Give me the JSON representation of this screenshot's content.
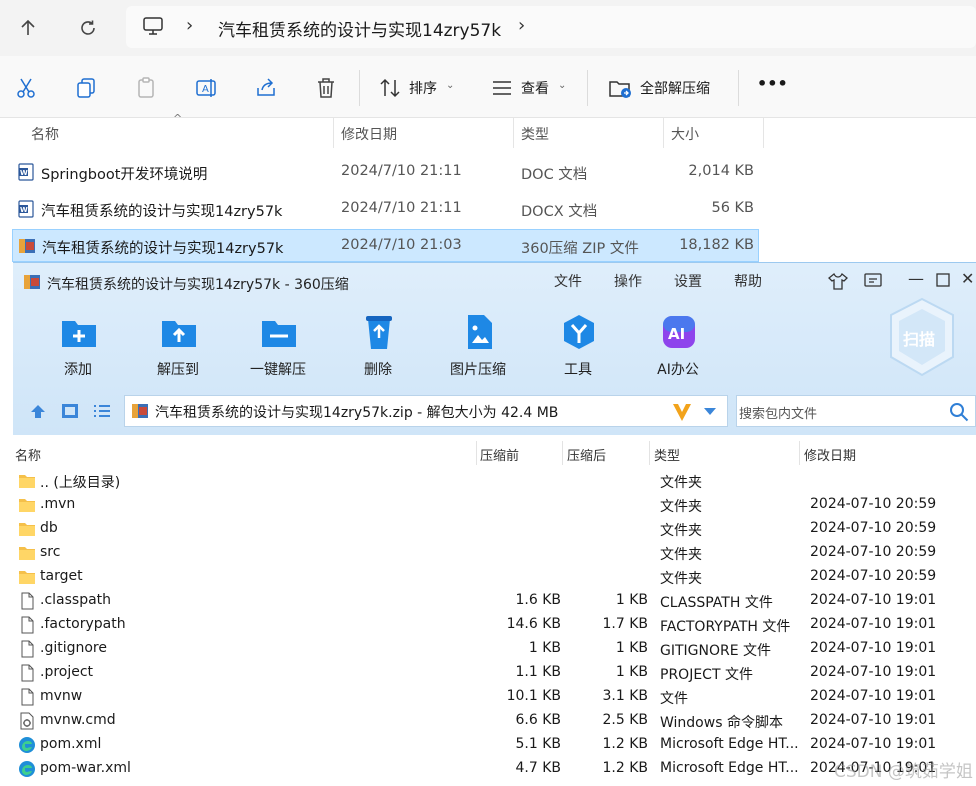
{
  "explorer": {
    "path_folder": "汽车租赁系统的设计与实现14zry57k",
    "toolbar": {
      "sort_label": "排序",
      "view_label": "查看",
      "extract_all_label": "全部解压缩",
      "more_label": "•••"
    },
    "columns": {
      "name": "名称",
      "modified": "修改日期",
      "type": "类型",
      "size": "大小"
    },
    "files": [
      {
        "name": "Springboot开发环境说明",
        "modified": "2024/7/10 21:11",
        "type": "DOC 文档",
        "size": "2,014 KB",
        "icon": "word-doc-icon"
      },
      {
        "name": "汽车租赁系统的设计与实现14zry57k",
        "modified": "2024/7/10 21:11",
        "type": "DOCX 文档",
        "size": "56 KB",
        "icon": "word-doc-icon"
      },
      {
        "name": "汽车租赁系统的设计与实现14zry57k",
        "modified": "2024/7/10 21:03",
        "type": "360压缩 ZIP 文件",
        "size": "18,182 KB",
        "icon": "zip-archive-icon",
        "selected": true
      }
    ]
  },
  "zip": {
    "title": "汽车租赁系统的设计与实现14zry57k - 360压缩",
    "menu": [
      "文件",
      "操作",
      "设置",
      "帮助"
    ],
    "tools": [
      "添加",
      "解压到",
      "一键解压",
      "删除",
      "图片压缩",
      "工具",
      "AI办公"
    ],
    "scan_label": "扫描",
    "path_text": "汽车租赁系统的设计与实现14zry57k.zip - 解包大小为 42.4 MB",
    "search_placeholder": "搜索包内文件",
    "columns": {
      "name": "名称",
      "packed_before": "压缩前",
      "packed_after": "压缩后",
      "type": "类型",
      "modified": "修改日期"
    },
    "rows": [
      {
        "name": ".. (上级目录)",
        "before": "",
        "after": "",
        "type": "文件夹",
        "modified": "",
        "icon": "folder-icon"
      },
      {
        "name": ".mvn",
        "before": "",
        "after": "",
        "type": "文件夹",
        "modified": "2024-07-10 20:59",
        "icon": "folder-icon"
      },
      {
        "name": "db",
        "before": "",
        "after": "",
        "type": "文件夹",
        "modified": "2024-07-10 20:59",
        "icon": "folder-icon"
      },
      {
        "name": "src",
        "before": "",
        "after": "",
        "type": "文件夹",
        "modified": "2024-07-10 20:59",
        "icon": "folder-icon"
      },
      {
        "name": "target",
        "before": "",
        "after": "",
        "type": "文件夹",
        "modified": "2024-07-10 20:59",
        "icon": "folder-icon"
      },
      {
        "name": ".classpath",
        "before": "1.6 KB",
        "after": "1 KB",
        "type": "CLASSPATH 文件",
        "modified": "2024-07-10 19:01",
        "icon": "file-icon"
      },
      {
        "name": ".factorypath",
        "before": "14.6 KB",
        "after": "1.7 KB",
        "type": "FACTORYPATH 文件",
        "modified": "2024-07-10 19:01",
        "icon": "file-icon"
      },
      {
        "name": ".gitignore",
        "before": "1 KB",
        "after": "1 KB",
        "type": "GITIGNORE 文件",
        "modified": "2024-07-10 19:01",
        "icon": "file-icon"
      },
      {
        "name": ".project",
        "before": "1.1 KB",
        "after": "1 KB",
        "type": "PROJECT 文件",
        "modified": "2024-07-10 19:01",
        "icon": "file-icon"
      },
      {
        "name": "mvnw",
        "before": "10.1 KB",
        "after": "3.1 KB",
        "type": "文件",
        "modified": "2024-07-10 19:01",
        "icon": "file-icon"
      },
      {
        "name": "mvnw.cmd",
        "before": "6.6 KB",
        "after": "2.5 KB",
        "type": "Windows 命令脚本",
        "modified": "2024-07-10 19:01",
        "icon": "cmd-script-icon"
      },
      {
        "name": "pom.xml",
        "before": "5.1 KB",
        "after": "1.2 KB",
        "type": "Microsoft Edge HT...",
        "modified": "2024-07-10 19:01",
        "icon": "edge-icon"
      },
      {
        "name": "pom-war.xml",
        "before": "4.7 KB",
        "after": "1.2 KB",
        "type": "Microsoft Edge HT...",
        "modified": "2024-07-10 19:01",
        "icon": "edge-icon"
      }
    ],
    "watermark": "CSDN @筑茹学姐"
  }
}
